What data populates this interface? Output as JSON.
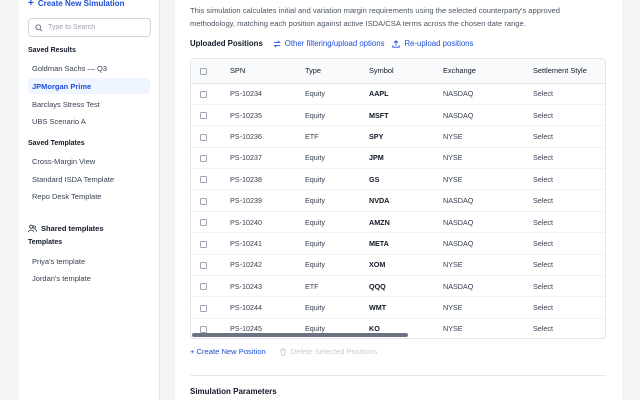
{
  "sidebar": {
    "create_label": "Create New Simulation",
    "search_placeholder": "Type to Search",
    "saved_results_title": "Saved Results",
    "saved_results": [
      "Goldman Sachs — Q3",
      "JPMorgan Prime",
      "Barclays Stress Test",
      "UBS Scenario A"
    ],
    "active_result": "JPMorgan Prime",
    "saved_templates_title": "Saved Templates",
    "saved_templates": [
      "Cross-Margin View",
      "Standard ISDA Template",
      "Repo Desk Template"
    ],
    "shared_title": "Shared templates",
    "templates_title": "Templates",
    "templates": [
      "Priya's template",
      "Jordan's template"
    ]
  },
  "main": {
    "description": "This simulation calculates initial and variation margin requirements using the selected counterparty's approved methodology, matching each position against active ISDA/CSA terms across the chosen date range.",
    "positions_title": "Uploaded Positions",
    "filter_link": "Other filtering/upload options",
    "reupload_link": "Re-upload positions",
    "columns": [
      "SPN",
      "Type",
      "Symbol",
      "Exchange",
      "Settlement Style"
    ],
    "rows": [
      [
        "PS-10234",
        "Equity",
        "AAPL",
        "NASDAQ",
        "Select"
      ],
      [
        "PS-10235",
        "Equity",
        "MSFT",
        "NASDAQ",
        "Select"
      ],
      [
        "PS-10236",
        "ETF",
        "SPY",
        "NYSE",
        "Select"
      ],
      [
        "PS-10237",
        "Equity",
        "JPM",
        "NYSE",
        "Select"
      ],
      [
        "PS-10238",
        "Equity",
        "GS",
        "NYSE",
        "Select"
      ],
      [
        "PS-10239",
        "Equity",
        "NVDA",
        "NASDAQ",
        "Select"
      ],
      [
        "PS-10240",
        "Equity",
        "AMZN",
        "NASDAQ",
        "Select"
      ],
      [
        "PS-10241",
        "Equity",
        "META",
        "NASDAQ",
        "Select"
      ],
      [
        "PS-10242",
        "Equity",
        "XOM",
        "NYSE",
        "Select"
      ],
      [
        "PS-10243",
        "ETF",
        "QQQ",
        "NASDAQ",
        "Select"
      ],
      [
        "PS-10244",
        "Equity",
        "WMT",
        "NYSE",
        "Select"
      ],
      [
        "PS-10245",
        "Equity",
        "KO",
        "NYSE",
        "Select"
      ]
    ],
    "create_position": "+ Create New Position",
    "delete_positions": "Delete Selected Positions",
    "params_title": "Simulation Parameters"
  },
  "colors": {
    "accent": "#1d4ed8",
    "active_bg": "#eff6ff"
  }
}
